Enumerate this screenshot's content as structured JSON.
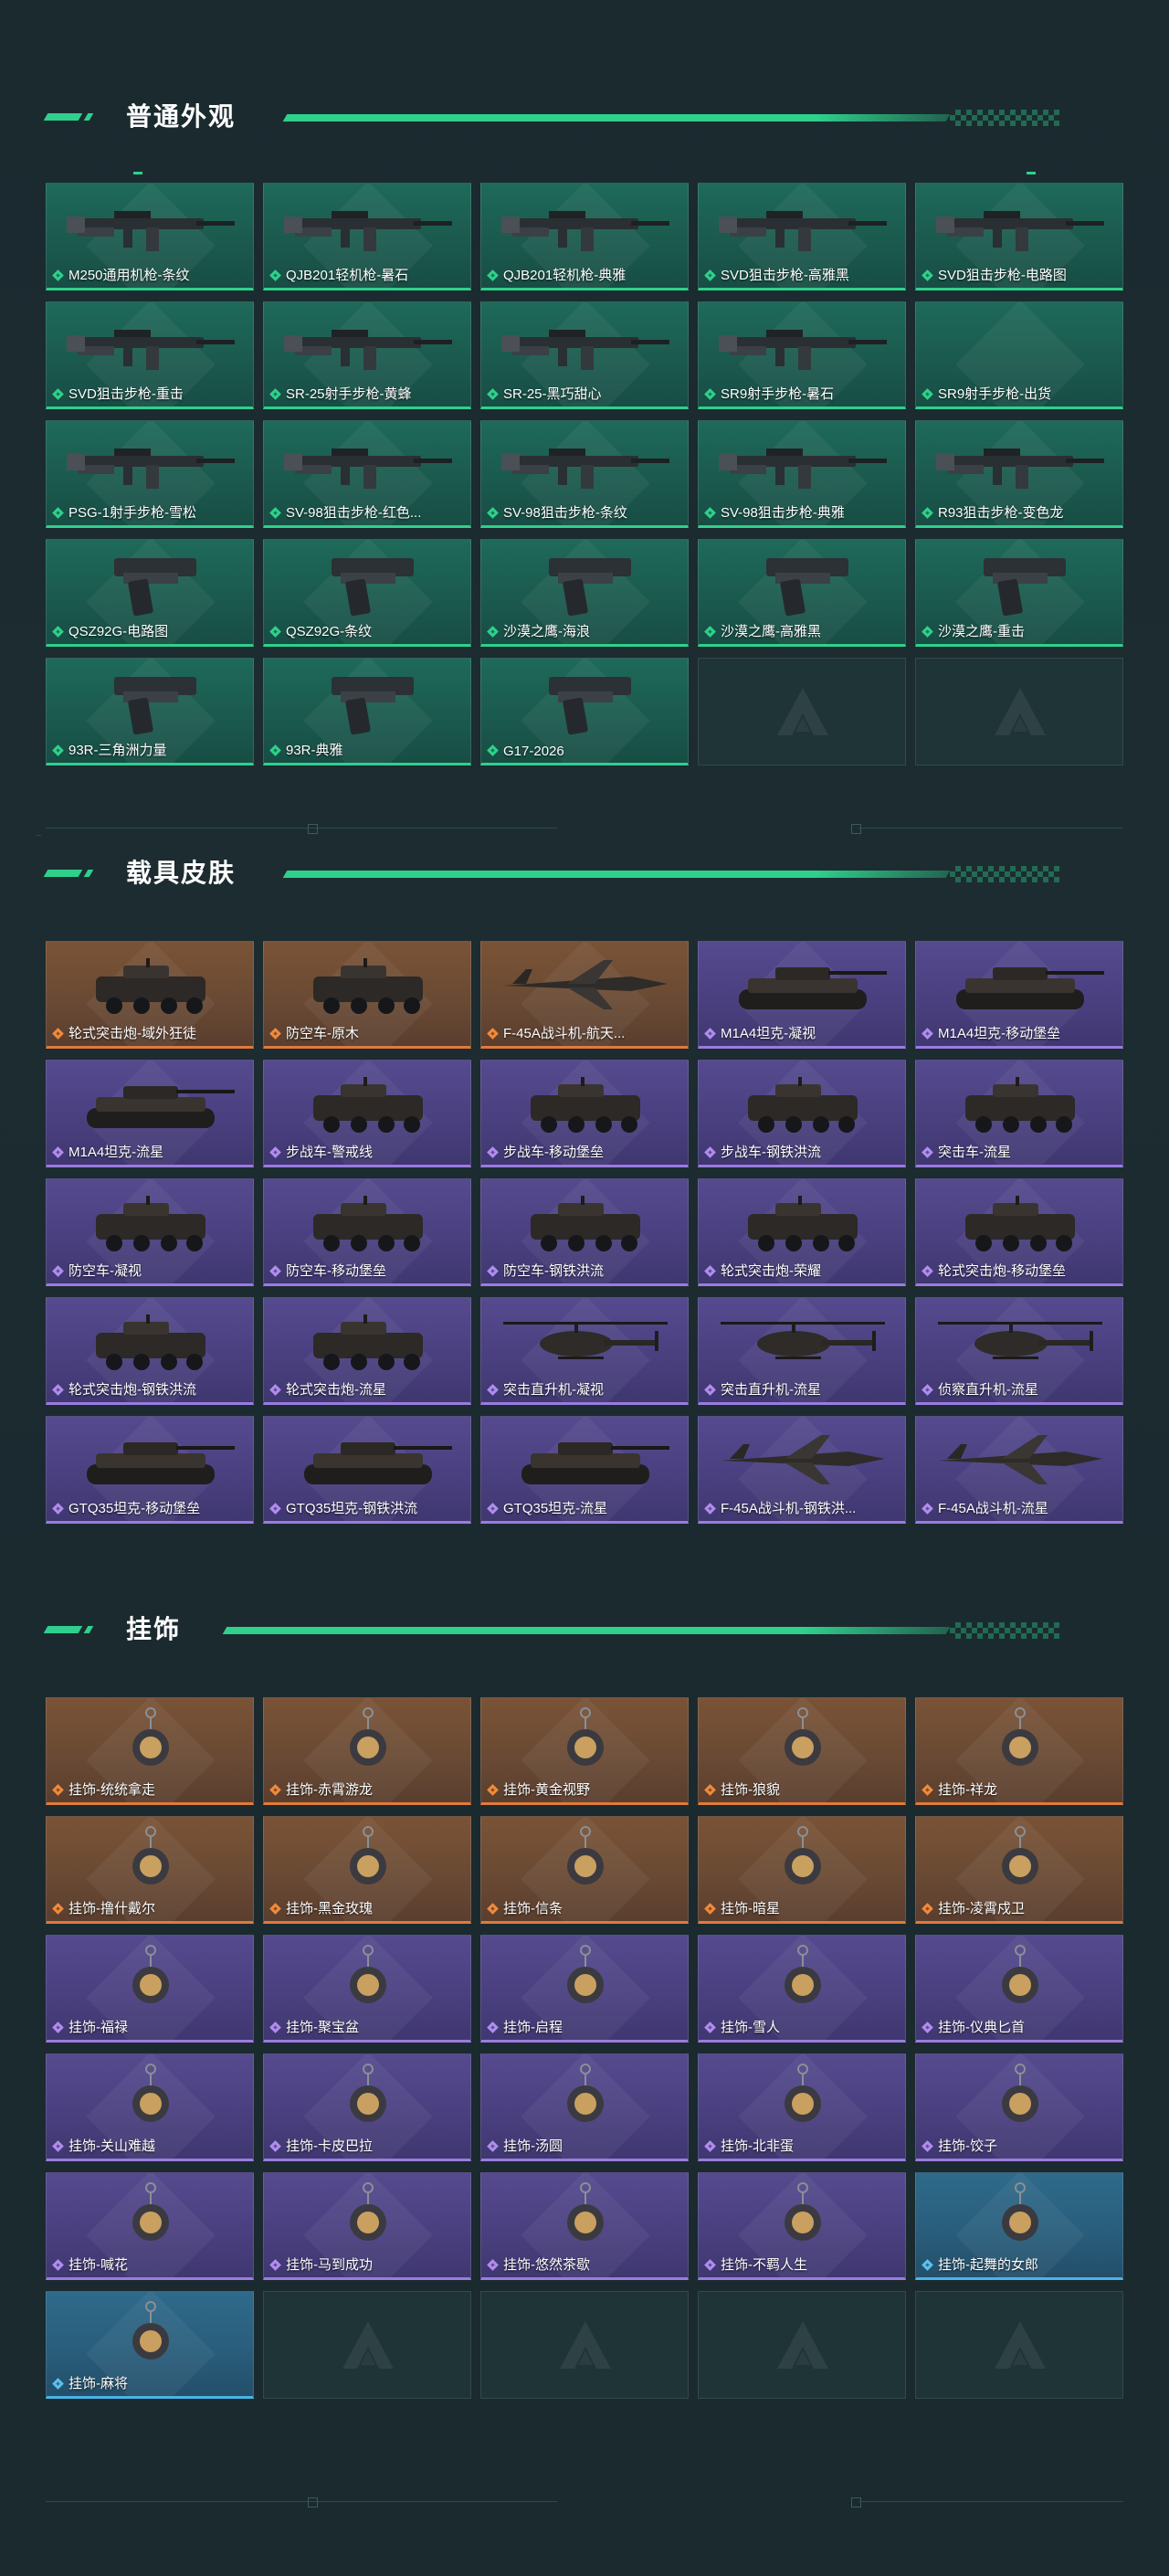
{
  "sections": [
    {
      "id": "weapon-skins",
      "title": "普通外观",
      "items": [
        {
          "label": "M250通用机枪-条纹",
          "rarity": "green",
          "art": "gun"
        },
        {
          "label": "QJB201轻机枪-暑石",
          "rarity": "green",
          "art": "gun"
        },
        {
          "label": "QJB201轻机枪-典雅",
          "rarity": "green",
          "art": "gun"
        },
        {
          "label": "SVD狙击步枪-高雅黑",
          "rarity": "green",
          "art": "gun"
        },
        {
          "label": "SVD狙击步枪-电路图",
          "rarity": "green",
          "art": "gun"
        },
        {
          "label": "SVD狙击步枪-重击",
          "rarity": "green",
          "art": "gun"
        },
        {
          "label": "SR-25射手步枪-黄蜂",
          "rarity": "green",
          "art": "gun"
        },
        {
          "label": "SR-25-黑巧甜心",
          "rarity": "green",
          "art": "gun"
        },
        {
          "label": "SR9射手步枪-暑石",
          "rarity": "green",
          "art": "gun"
        },
        {
          "label": "SR9射手步枪-出货",
          "rarity": "green",
          "art": "none"
        },
        {
          "label": "PSG-1射手步枪-雪松",
          "rarity": "green",
          "art": "gun"
        },
        {
          "label": "SV-98狙击步枪-红色...",
          "rarity": "green",
          "art": "gun"
        },
        {
          "label": "SV-98狙击步枪-条纹",
          "rarity": "green",
          "art": "gun"
        },
        {
          "label": "SV-98狙击步枪-典雅",
          "rarity": "green",
          "art": "gun"
        },
        {
          "label": "R93狙击步枪-变色龙",
          "rarity": "green",
          "art": "gun"
        },
        {
          "label": "QSZ92G-电路图",
          "rarity": "green",
          "art": "pistol"
        },
        {
          "label": "QSZ92G-条纹",
          "rarity": "green",
          "art": "pistol"
        },
        {
          "label": "沙漠之鹰-海浪",
          "rarity": "green",
          "art": "pistol"
        },
        {
          "label": "沙漠之鹰-高雅黑",
          "rarity": "green",
          "art": "pistol"
        },
        {
          "label": "沙漠之鹰-重击",
          "rarity": "green",
          "art": "pistol"
        },
        {
          "label": "93R-三角洲力量",
          "rarity": "green",
          "art": "pistol"
        },
        {
          "label": "93R-典雅",
          "rarity": "green",
          "art": "pistol"
        },
        {
          "label": "G17-2026",
          "rarity": "green",
          "art": "pistol"
        },
        {
          "label": "",
          "rarity": "empty",
          "art": "none"
        },
        {
          "label": "",
          "rarity": "empty",
          "art": "none"
        }
      ]
    },
    {
      "id": "vehicle-skins",
      "title": "载具皮肤",
      "items": [
        {
          "label": "轮式突击炮-域外狂徒",
          "rarity": "orange",
          "art": "vehicle"
        },
        {
          "label": "防空车-原木",
          "rarity": "orange",
          "art": "vehicle"
        },
        {
          "label": "F-45A战斗机-航天...",
          "rarity": "orange",
          "art": "jet"
        },
        {
          "label": "M1A4坦克-凝视",
          "rarity": "purple",
          "art": "tank"
        },
        {
          "label": "M1A4坦克-移动堡垒",
          "rarity": "purple",
          "art": "tank"
        },
        {
          "label": "M1A4坦克-流星",
          "rarity": "purple",
          "art": "tank"
        },
        {
          "label": "步战车-警戒线",
          "rarity": "purple",
          "art": "vehicle"
        },
        {
          "label": "步战车-移动堡垒",
          "rarity": "purple",
          "art": "vehicle"
        },
        {
          "label": "步战车-钢铁洪流",
          "rarity": "purple",
          "art": "vehicle"
        },
        {
          "label": "突击车-流星",
          "rarity": "purple",
          "art": "vehicle"
        },
        {
          "label": "防空车-凝视",
          "rarity": "purple",
          "art": "vehicle"
        },
        {
          "label": "防空车-移动堡垒",
          "rarity": "purple",
          "art": "vehicle"
        },
        {
          "label": "防空车-钢铁洪流",
          "rarity": "purple",
          "art": "vehicle"
        },
        {
          "label": "轮式突击炮-荣耀",
          "rarity": "purple",
          "art": "vehicle"
        },
        {
          "label": "轮式突击炮-移动堡垒",
          "rarity": "purple",
          "art": "vehicle"
        },
        {
          "label": "轮式突击炮-钢铁洪流",
          "rarity": "purple",
          "art": "vehicle"
        },
        {
          "label": "轮式突击炮-流星",
          "rarity": "purple",
          "art": "vehicle"
        },
        {
          "label": "突击直升机-凝视",
          "rarity": "purple",
          "art": "heli"
        },
        {
          "label": "突击直升机-流星",
          "rarity": "purple",
          "art": "heli"
        },
        {
          "label": "侦察直升机-流星",
          "rarity": "purple",
          "art": "heli"
        },
        {
          "label": "GTQ35坦克-移动堡垒",
          "rarity": "purple",
          "art": "tank"
        },
        {
          "label": "GTQ35坦克-钢铁洪流",
          "rarity": "purple",
          "art": "tank"
        },
        {
          "label": "GTQ35坦克-流星",
          "rarity": "purple",
          "art": "tank"
        },
        {
          "label": "F-45A战斗机-钢铁洪...",
          "rarity": "purple",
          "art": "jet"
        },
        {
          "label": "F-45A战斗机-流星",
          "rarity": "purple",
          "art": "jet"
        }
      ]
    },
    {
      "id": "charms",
      "title": "挂饰",
      "items": [
        {
          "label": "挂饰-统统拿走",
          "rarity": "orange",
          "art": "charm"
        },
        {
          "label": "挂饰-赤霄游龙",
          "rarity": "orange",
          "art": "charm"
        },
        {
          "label": "挂饰-黄金视野",
          "rarity": "orange",
          "art": "charm"
        },
        {
          "label": "挂饰-狼貌",
          "rarity": "orange",
          "art": "charm"
        },
        {
          "label": "挂饰-祥龙",
          "rarity": "orange",
          "art": "charm"
        },
        {
          "label": "挂饰-撸什戴尔",
          "rarity": "orange",
          "art": "charm"
        },
        {
          "label": "挂饰-黑金玫瑰",
          "rarity": "orange",
          "art": "charm"
        },
        {
          "label": "挂饰-信条",
          "rarity": "orange",
          "art": "charm"
        },
        {
          "label": "挂饰-暗星",
          "rarity": "orange",
          "art": "charm"
        },
        {
          "label": "挂饰-凌霄戍卫",
          "rarity": "orange",
          "art": "charm"
        },
        {
          "label": "挂饰-福禄",
          "rarity": "purple",
          "art": "charm"
        },
        {
          "label": "挂饰-聚宝盆",
          "rarity": "purple",
          "art": "charm"
        },
        {
          "label": "挂饰-启程",
          "rarity": "purple",
          "art": "charm"
        },
        {
          "label": "挂饰-雪人",
          "rarity": "purple",
          "art": "charm"
        },
        {
          "label": "挂饰-仪典匕首",
          "rarity": "purple",
          "art": "charm"
        },
        {
          "label": "挂饰-关山难越",
          "rarity": "purple",
          "art": "charm"
        },
        {
          "label": "挂饰-卡皮巴拉",
          "rarity": "purple",
          "art": "charm"
        },
        {
          "label": "挂饰-汤圆",
          "rarity": "purple",
          "art": "charm"
        },
        {
          "label": "挂饰-北非蛋",
          "rarity": "purple",
          "art": "charm"
        },
        {
          "label": "挂饰-饺子",
          "rarity": "purple",
          "art": "charm"
        },
        {
          "label": "挂饰-喊花",
          "rarity": "purple",
          "art": "charm"
        },
        {
          "label": "挂饰-马到成功",
          "rarity": "purple",
          "art": "charm"
        },
        {
          "label": "挂饰-悠然茶歇",
          "rarity": "purple",
          "art": "charm"
        },
        {
          "label": "挂饰-不羁人生",
          "rarity": "purple",
          "art": "charm"
        },
        {
          "label": "挂饰-起舞的女郎",
          "rarity": "blue",
          "art": "charm"
        },
        {
          "label": "挂饰-麻将",
          "rarity": "blue",
          "art": "charm"
        },
        {
          "label": "",
          "rarity": "empty",
          "art": "none"
        },
        {
          "label": "",
          "rarity": "empty",
          "art": "none"
        },
        {
          "label": "",
          "rarity": "empty",
          "art": "none"
        },
        {
          "label": "",
          "rarity": "empty",
          "art": "none"
        }
      ]
    }
  ],
  "colors": {
    "accent": "#2fd08c",
    "green_card": "#1b5a4e",
    "orange_card": "#6a4a34",
    "purple_card": "#4a4080",
    "blue_card": "#295e7c",
    "background": "#1b2a2f"
  }
}
